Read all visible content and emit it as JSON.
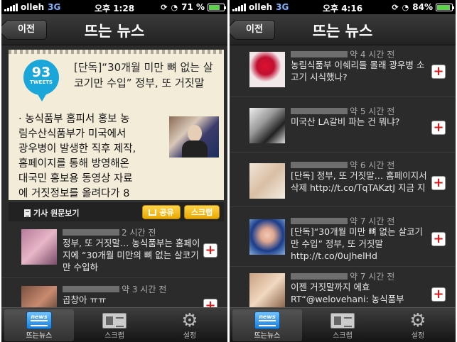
{
  "left": {
    "status": {
      "carrier": "olleh",
      "network": "3G",
      "time": "오후 1:28",
      "battery": "71 %",
      "battery_level": 0.71
    },
    "nav": {
      "back_label": "이전",
      "title": "뜨는 뉴스"
    },
    "featured": {
      "tweet_count": "93",
      "tweet_label": "TWEETS",
      "title": "[단독]“30개월 미만 뼈 없는 살코기만 수입” 정부, 또 거짓말",
      "body_lines": [
        "· 농식품부 홈피서 홍보 농",
        "림수산식품부가 미국에서",
        "광우병이 발생한 직후 제작,",
        "홈페이지를 통해 방영해온",
        "대국민 홍보용 동영상 자료",
        "에 거짓정보를 올려다가 8"
      ],
      "original_link": "기사 원문보기",
      "share_label": "공유",
      "scrap_label": "스크랩"
    },
    "items": [
      {
        "time": "2 시간 전",
        "text": "정부, 또 거짓말… 농식품부는 홈페이지에 “30개월 미만의 뼈 없는 살코기만 수입하",
        "add": "+"
      },
      {
        "time": "약 3 시간 전",
        "text": "곱창아 ㅠㅠ",
        "add": "+"
      }
    ],
    "tabs": [
      {
        "label": "뜨는뉴스",
        "icon_text": "news"
      },
      {
        "label": "스크랩"
      },
      {
        "label": "설정"
      }
    ]
  },
  "right": {
    "status": {
      "carrier": "olleh",
      "network": "3G",
      "time": "오후 4:16",
      "battery": "84%",
      "battery_level": 0.84
    },
    "nav": {
      "back_label": "이전",
      "title": "뜨는 뉴스"
    },
    "items": [
      {
        "time": "약 4 시간 전",
        "text": "농림식품부 이쉐리들 몰래 광우병 소고기 시식했나?",
        "add": "+"
      },
      {
        "time": "약 5 시간 전",
        "text": "미국산 LA갈비 파는 건 뭐냐?",
        "add": "+"
      },
      {
        "time": "약 6 시간 전",
        "text": "[단독] 정부, 또 거짓말… 홈페이지서 삭제 http://t.co/TqTAKztJ 지금 지",
        "add": "+"
      },
      {
        "time": "약 7 시간 전",
        "text": "[단독]“30개월 미만 뼈 없는 살코기만 수입” 정부, 또 거짓말 http://t.co/0uJhelHd",
        "add": "+"
      },
      {
        "time": "약 7 시간 전",
        "text": "이젠 거짓말까지 에효 RT“@welovehani: 농식품부",
        "add": "+"
      }
    ],
    "tabs": [
      {
        "label": "뜨는뉴스",
        "icon_text": "news"
      },
      {
        "label": "스크랩"
      },
      {
        "label": "설정"
      }
    ]
  }
}
